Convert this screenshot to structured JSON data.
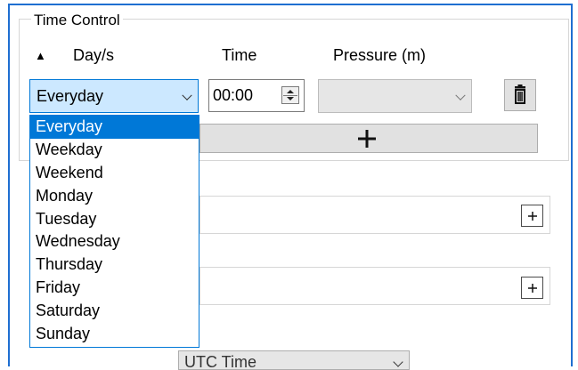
{
  "time_control": {
    "title": "Time Control",
    "headers": {
      "days": "Day/s",
      "time": "Time",
      "pressure": "Pressure (m)"
    },
    "sort_icon": "triangle-up-icon",
    "row": {
      "day_value": "Everyday",
      "time_value": "00:00",
      "pressure_value": ""
    },
    "delete_icon": "trash-icon",
    "add_icon": "plus-icon"
  },
  "dropdown": {
    "options": [
      "Everyday",
      "Weekday",
      "Weekend",
      "Monday",
      "Tuesday",
      "Wednesday",
      "Thursday",
      "Friday",
      "Saturday",
      "Sunday"
    ],
    "selected_index": 0
  },
  "timezone_combo": {
    "value": "UTC Time"
  },
  "colors": {
    "accent": "#0078d7",
    "frame": "#1f6fd1",
    "button_bg": "#e1e1e1",
    "combo_highlight": "#cce8ff"
  }
}
